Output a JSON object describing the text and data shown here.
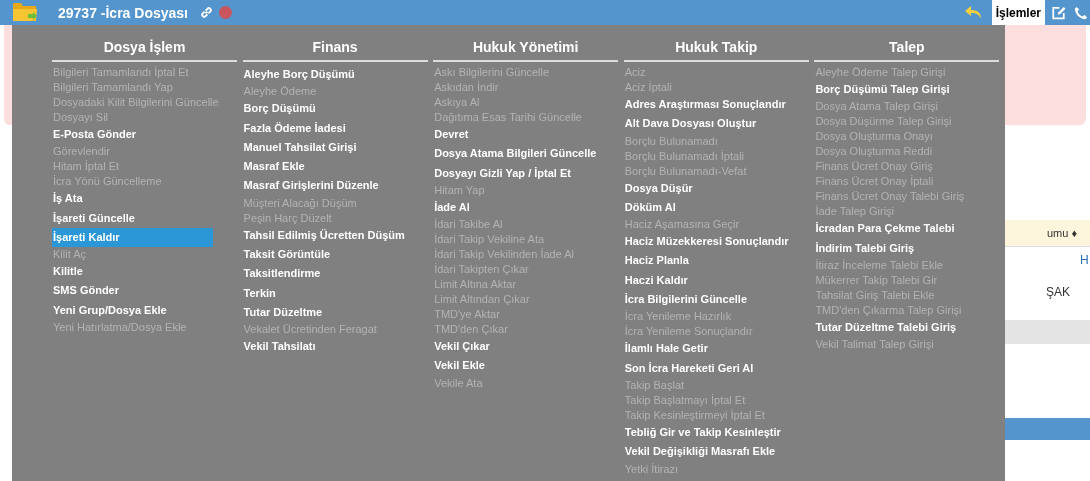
{
  "header": {
    "title": "29737 -İcra Dosyası",
    "actions_button": "İşlemler"
  },
  "background_table": {
    "header_fragment": "umu ♦",
    "cell_fragment_1": "H",
    "cell_fragment_2": "ŞAK"
  },
  "menu": [
    {
      "title": "Dosya İşlem",
      "items": [
        {
          "label": "Bilgileri Tamamlandı İptal Et",
          "disabled": true,
          "selected": false
        },
        {
          "label": "Bilgileri Tamamlandı Yap",
          "disabled": true,
          "selected": false
        },
        {
          "label": "Dosyadaki Kilit Bilgilerini Güncelle",
          "disabled": true,
          "selected": false
        },
        {
          "label": "Dosyayı Sil",
          "disabled": true,
          "selected": false
        },
        {
          "label": "E-Posta Gönder",
          "disabled": false,
          "selected": false
        },
        {
          "label": "Görevlendir",
          "disabled": true,
          "selected": false
        },
        {
          "label": "Hitam İptal Et",
          "disabled": true,
          "selected": false
        },
        {
          "label": "İcra Yönü Güncelleme",
          "disabled": true,
          "selected": false
        },
        {
          "label": "İş Ata",
          "disabled": false,
          "selected": false
        },
        {
          "label": "İşareti Güncelle",
          "disabled": false,
          "selected": false
        },
        {
          "label": "İşareti Kaldır",
          "disabled": false,
          "selected": true
        },
        {
          "label": "Kilit Aç",
          "disabled": true,
          "selected": false
        },
        {
          "label": "Kilitle",
          "disabled": false,
          "selected": false
        },
        {
          "label": "SMS Gönder",
          "disabled": false,
          "selected": false
        },
        {
          "label": "Yeni Grup/Dosya Ekle",
          "disabled": false,
          "selected": false
        },
        {
          "label": "Yeni Hatırlatma/Dosya Ekle",
          "disabled": true,
          "selected": false
        }
      ]
    },
    {
      "title": "Finans",
      "items": [
        {
          "label": "Aleyhe Borç Düşümü",
          "disabled": false,
          "selected": false
        },
        {
          "label": "Aleyhe Ödeme",
          "disabled": true,
          "selected": false
        },
        {
          "label": "Borç Düşümü",
          "disabled": false,
          "selected": false
        },
        {
          "label": "Fazla Ödeme İadesi",
          "disabled": false,
          "selected": false
        },
        {
          "label": "Manuel Tahsilat Girişi",
          "disabled": false,
          "selected": false
        },
        {
          "label": "Masraf Ekle",
          "disabled": false,
          "selected": false
        },
        {
          "label": "Masraf Girişlerini Düzenle",
          "disabled": false,
          "selected": false
        },
        {
          "label": "Müşteri Alacağı Düşüm",
          "disabled": true,
          "selected": false
        },
        {
          "label": "Peşin Harç Düzelt",
          "disabled": true,
          "selected": false
        },
        {
          "label": "Tahsil Edilmiş Ücretten Düşüm",
          "disabled": false,
          "selected": false
        },
        {
          "label": "Taksit Görüntüle",
          "disabled": false,
          "selected": false
        },
        {
          "label": "Taksitlendirme",
          "disabled": false,
          "selected": false
        },
        {
          "label": "Terkin",
          "disabled": false,
          "selected": false
        },
        {
          "label": "Tutar Düzeltme",
          "disabled": false,
          "selected": false
        },
        {
          "label": "Vekalet Ücretinden Feragat",
          "disabled": true,
          "selected": false
        },
        {
          "label": "Vekil Tahsilatı",
          "disabled": false,
          "selected": false
        }
      ]
    },
    {
      "title": "Hukuk Yönetimi",
      "items": [
        {
          "label": "Askı Bilgilerini Güncelle",
          "disabled": true,
          "selected": false
        },
        {
          "label": "Askıdan İndir",
          "disabled": true,
          "selected": false
        },
        {
          "label": "Askıya Al",
          "disabled": true,
          "selected": false
        },
        {
          "label": "Dağıtıma Esas Tarihi Güncelle",
          "disabled": true,
          "selected": false
        },
        {
          "label": "Devret",
          "disabled": false,
          "selected": false
        },
        {
          "label": "Dosya Atama Bilgileri Güncelle",
          "disabled": false,
          "selected": false
        },
        {
          "label": "Dosyayı Gizli Yap / İptal Et",
          "disabled": false,
          "selected": false
        },
        {
          "label": "Hitam Yap",
          "disabled": true,
          "selected": false
        },
        {
          "label": "İade Al",
          "disabled": false,
          "selected": false
        },
        {
          "label": "İdari Takibe Al",
          "disabled": true,
          "selected": false
        },
        {
          "label": "İdari Takip Vekiline Ata",
          "disabled": true,
          "selected": false
        },
        {
          "label": "İdari Takip Vekilinden İade Al",
          "disabled": true,
          "selected": false
        },
        {
          "label": "İdari Takipten Çıkar",
          "disabled": true,
          "selected": false
        },
        {
          "label": "Limit Altına Aktar",
          "disabled": true,
          "selected": false
        },
        {
          "label": "Limit Altından Çıkar",
          "disabled": true,
          "selected": false
        },
        {
          "label": "TMD'ye Aktar",
          "disabled": true,
          "selected": false
        },
        {
          "label": "TMD'den Çıkar",
          "disabled": true,
          "selected": false
        },
        {
          "label": "Vekil Çıkar",
          "disabled": false,
          "selected": false
        },
        {
          "label": "Vekil Ekle",
          "disabled": false,
          "selected": false
        },
        {
          "label": "Vekile Ata",
          "disabled": true,
          "selected": false
        }
      ]
    },
    {
      "title": "Hukuk Takip",
      "items": [
        {
          "label": "Aciz",
          "disabled": true,
          "selected": false
        },
        {
          "label": "Aciz İptali",
          "disabled": true,
          "selected": false
        },
        {
          "label": "Adres Araştırması Sonuçlandır",
          "disabled": false,
          "selected": false
        },
        {
          "label": "Alt Dava Dosyası Oluştur",
          "disabled": false,
          "selected": false
        },
        {
          "label": "Borçlu Bulunamadı",
          "disabled": true,
          "selected": false
        },
        {
          "label": "Borçlu Bulunamadı İptali",
          "disabled": true,
          "selected": false
        },
        {
          "label": "Borçlu Bulunamadı-Vefat",
          "disabled": true,
          "selected": false
        },
        {
          "label": "Dosya Düşür",
          "disabled": false,
          "selected": false
        },
        {
          "label": "Döküm Al",
          "disabled": false,
          "selected": false
        },
        {
          "label": "Haciz Aşamasına Geçir",
          "disabled": true,
          "selected": false
        },
        {
          "label": "Haciz Müzekkeresi Sonuçlandır",
          "disabled": false,
          "selected": false
        },
        {
          "label": "Haciz Planla",
          "disabled": false,
          "selected": false
        },
        {
          "label": "Haczi Kaldır",
          "disabled": false,
          "selected": false
        },
        {
          "label": "İcra Bilgilerini Güncelle",
          "disabled": false,
          "selected": false
        },
        {
          "label": "İcra Yenileme Hazırlık",
          "disabled": true,
          "selected": false
        },
        {
          "label": "İcra Yenileme Sonuçlandır",
          "disabled": true,
          "selected": false
        },
        {
          "label": "İlamlı Hale Getir",
          "disabled": false,
          "selected": false
        },
        {
          "label": "Son İcra Hareketi Geri Al",
          "disabled": false,
          "selected": false
        },
        {
          "label": "Takip Başlat",
          "disabled": true,
          "selected": false
        },
        {
          "label": "Takip Başlatmayı İptal Et",
          "disabled": true,
          "selected": false
        },
        {
          "label": "Takip Kesinleştirmeyi İptal Et",
          "disabled": true,
          "selected": false
        },
        {
          "label": "Tebliğ Gir ve Takip Kesinleştir",
          "disabled": false,
          "selected": false
        },
        {
          "label": "Vekil Değişikliği Masrafı Ekle",
          "disabled": false,
          "selected": false
        },
        {
          "label": "Yetki İtirazı",
          "disabled": true,
          "selected": false
        }
      ]
    },
    {
      "title": "Talep",
      "items": [
        {
          "label": "Aleyhe Ödeme Talep Girişi",
          "disabled": true,
          "selected": false
        },
        {
          "label": "Borç Düşümü Talep Girişi",
          "disabled": false,
          "selected": false
        },
        {
          "label": "Dosya Atama Talep Girişi",
          "disabled": true,
          "selected": false
        },
        {
          "label": "Dosya Düşürme Talep Girişi",
          "disabled": true,
          "selected": false
        },
        {
          "label": "Dosya Oluşturma Onayı",
          "disabled": true,
          "selected": false
        },
        {
          "label": "Dosya Oluşturma Reddi",
          "disabled": true,
          "selected": false
        },
        {
          "label": "Finans Ücret Onay Giriş",
          "disabled": true,
          "selected": false
        },
        {
          "label": "Finans Ücret Onay İptali",
          "disabled": true,
          "selected": false
        },
        {
          "label": "Finans Ücret Onay Talebi Giriş",
          "disabled": true,
          "selected": false
        },
        {
          "label": "İade Talep Girişi",
          "disabled": true,
          "selected": false
        },
        {
          "label": "İcradan Para Çekme Talebi",
          "disabled": false,
          "selected": false
        },
        {
          "label": "İndirim Talebi Giriş",
          "disabled": false,
          "selected": false
        },
        {
          "label": "İtiraz İnceleme Talebi Ekle",
          "disabled": true,
          "selected": false
        },
        {
          "label": "Mükerrer Takip Talebi Gir",
          "disabled": true,
          "selected": false
        },
        {
          "label": "Tahsilat Giriş Talebi Ekle",
          "disabled": true,
          "selected": false
        },
        {
          "label": "TMD'den Çıkarma Talep Girişi",
          "disabled": true,
          "selected": false
        },
        {
          "label": "Tutar Düzeltme Talebi Giriş",
          "disabled": false,
          "selected": false
        },
        {
          "label": "Vekil Talimat Talep Girişi",
          "disabled": true,
          "selected": false
        }
      ]
    }
  ]
}
